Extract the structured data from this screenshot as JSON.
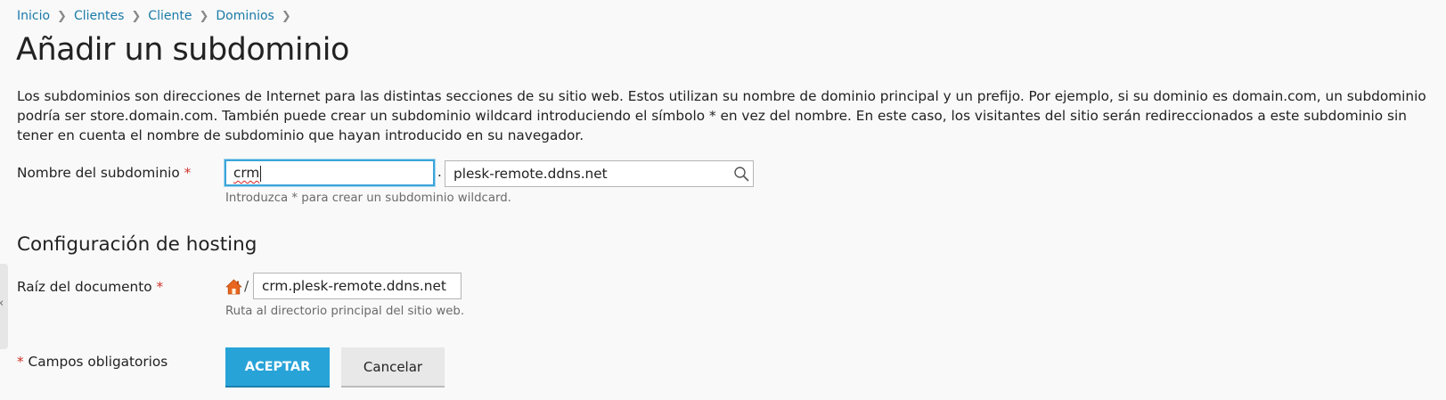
{
  "breadcrumb": [
    {
      "label": "Inicio"
    },
    {
      "label": "Clientes"
    },
    {
      "label": "Cliente"
    },
    {
      "label": "Dominios"
    }
  ],
  "page_title": "Añadir un subdominio",
  "description": "Los subdominios son direcciones de Internet para las distintas secciones de su sitio web. Estos utilizan su nombre de dominio principal y un prefijo. Por ejemplo, si su dominio es domain.com, un subdominio podría ser store.domain.com. También puede crear un subdominio wildcard introduciendo el símbolo * en vez del nombre. En este caso, los visitantes del sitio serán redireccionados a este subdominio sin tener en cuenta el nombre de subdominio que hayan introducido en su navegador.",
  "subdomain": {
    "label": "Nombre del subdominio",
    "required_marker": "*",
    "value": "crm",
    "separator": ".",
    "domain_value": "plesk-remote.ddns.net",
    "hint": "Introduzca * para crear un subdominio wildcard."
  },
  "hosting": {
    "section_title": "Configuración de hosting",
    "docroot_label": "Raíz del documento",
    "required_marker": "*",
    "path_separator": "/",
    "docroot_value": "crm.plesk-remote.ddns.net",
    "docroot_hint": "Ruta al directorio principal del sitio web."
  },
  "footer": {
    "required_marker": "*",
    "required_note": "Campos obligatorios",
    "ok_label": "ACEPTAR",
    "cancel_label": "Cancelar"
  },
  "side_handle_glyph": "‹",
  "colors": {
    "link": "#1a7aa8",
    "required": "#d0352c",
    "primary_button": "#28a3d8",
    "focus_border": "#3aa5d9",
    "home_icon": "#e8661f"
  },
  "icons": {
    "breadcrumb_separator": "chevron-right-icon",
    "domain_picker": "search-icon",
    "home": "home-icon"
  }
}
